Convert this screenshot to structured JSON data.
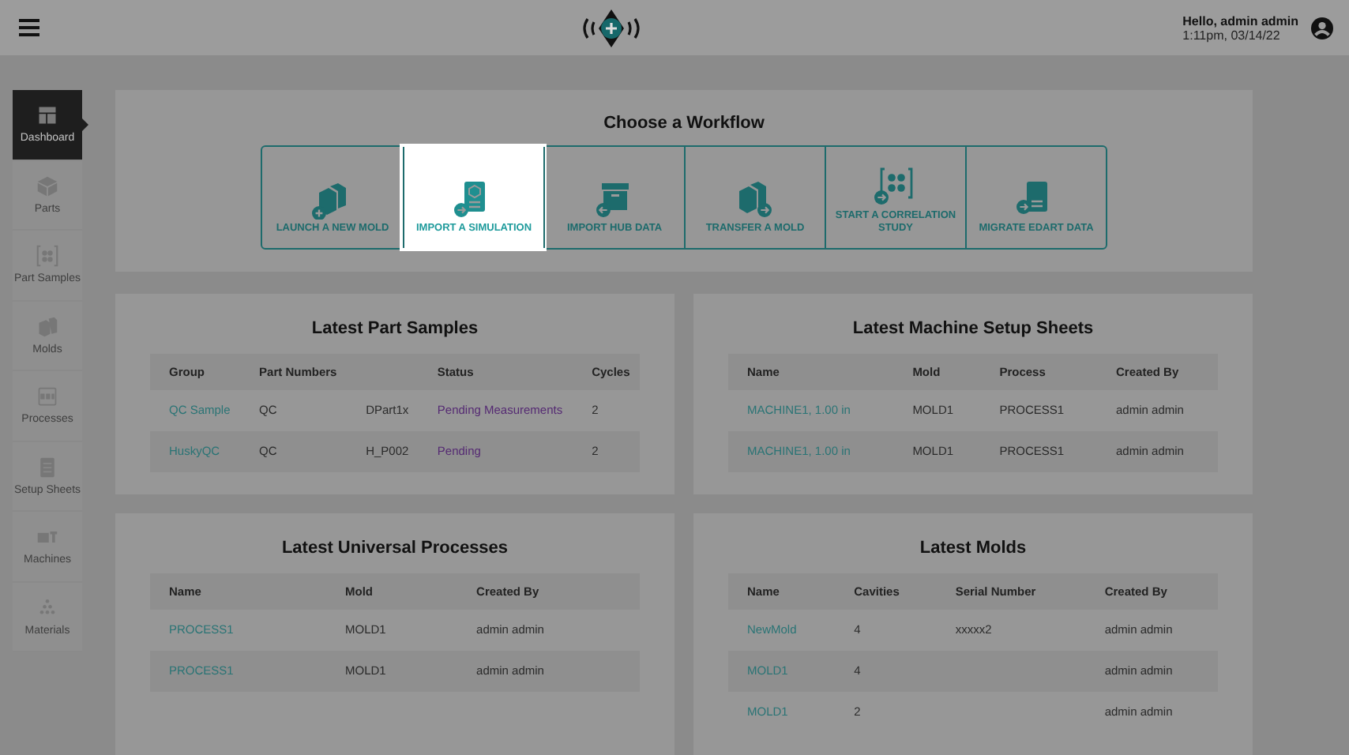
{
  "header": {
    "greeting": "Hello, admin admin",
    "timestamp": "1:11pm, 03/14/22"
  },
  "sidebar": {
    "items": [
      {
        "label": "Dashboard",
        "selected": true
      },
      {
        "label": "Parts",
        "selected": false
      },
      {
        "label": "Part Samples",
        "selected": false
      },
      {
        "label": "Molds",
        "selected": false
      },
      {
        "label": "Processes",
        "selected": false
      },
      {
        "label": "Setup Sheets",
        "selected": false
      },
      {
        "label": "Machines",
        "selected": false
      },
      {
        "label": "Materials",
        "selected": false
      }
    ]
  },
  "workflow": {
    "title": "Choose a Workflow",
    "tiles": [
      {
        "label": "LAUNCH A NEW MOLD",
        "selected": false
      },
      {
        "label": "IMPORT A SIMULATION",
        "selected": true
      },
      {
        "label": "IMPORT HUB DATA",
        "selected": false
      },
      {
        "label": "TRANSFER A MOLD",
        "selected": false
      },
      {
        "label": "START A CORRELATION STUDY",
        "selected": false
      },
      {
        "label": "MIGRATE EDART DATA",
        "selected": false
      }
    ]
  },
  "cards": [
    {
      "title": "Latest Part Samples",
      "columns": [
        "Group",
        "Part Numbers",
        "",
        "Status",
        "Cycles"
      ],
      "rows": [
        [
          {
            "text": "QC Sample",
            "kind": "link"
          },
          {
            "text": "QC",
            "kind": "plain"
          },
          {
            "text": "DPart1x",
            "kind": "plain"
          },
          {
            "text": "Pending Measurements",
            "kind": "status"
          },
          {
            "text": "2",
            "kind": "plain"
          }
        ],
        [
          {
            "text": "HuskyQC",
            "kind": "link"
          },
          {
            "text": "QC",
            "kind": "plain"
          },
          {
            "text": "H_P002",
            "kind": "plain"
          },
          {
            "text": "Pending",
            "kind": "status"
          },
          {
            "text": "2",
            "kind": "plain"
          }
        ]
      ]
    },
    {
      "title": "Latest Machine Setup Sheets",
      "columns": [
        "Name",
        "Mold",
        "Process",
        "Created By"
      ],
      "rows": [
        [
          {
            "text": "MACHINE1, 1.00 in",
            "kind": "link"
          },
          {
            "text": "MOLD1",
            "kind": "plain"
          },
          {
            "text": "PROCESS1",
            "kind": "plain"
          },
          {
            "text": "admin admin",
            "kind": "plain"
          }
        ],
        [
          {
            "text": "MACHINE1, 1.00 in",
            "kind": "link"
          },
          {
            "text": "MOLD1",
            "kind": "plain"
          },
          {
            "text": "PROCESS1",
            "kind": "plain"
          },
          {
            "text": "admin admin",
            "kind": "plain"
          }
        ]
      ]
    },
    {
      "title": "Latest Universal Processes",
      "columns": [
        "Name",
        "Mold",
        "Created By"
      ],
      "rows": [
        [
          {
            "text": "PROCESS1",
            "kind": "link"
          },
          {
            "text": "MOLD1",
            "kind": "plain"
          },
          {
            "text": "admin admin",
            "kind": "plain"
          }
        ],
        [
          {
            "text": "PROCESS1",
            "kind": "link"
          },
          {
            "text": "MOLD1",
            "kind": "plain"
          },
          {
            "text": "admin admin",
            "kind": "plain"
          }
        ]
      ]
    },
    {
      "title": "Latest Molds",
      "columns": [
        "Name",
        "Cavities",
        "Serial Number",
        "Created By"
      ],
      "rows": [
        [
          {
            "text": "NewMold",
            "kind": "link"
          },
          {
            "text": "4",
            "kind": "plain"
          },
          {
            "text": "xxxxx2",
            "kind": "plain"
          },
          {
            "text": "admin admin",
            "kind": "plain"
          }
        ],
        [
          {
            "text": "MOLD1",
            "kind": "link"
          },
          {
            "text": "4",
            "kind": "plain"
          },
          {
            "text": "",
            "kind": "plain"
          },
          {
            "text": "admin admin",
            "kind": "plain"
          }
        ],
        [
          {
            "text": "MOLD1",
            "kind": "link"
          },
          {
            "text": "2",
            "kind": "plain"
          },
          {
            "text": "",
            "kind": "plain"
          },
          {
            "text": "admin admin",
            "kind": "plain"
          }
        ]
      ]
    }
  ]
}
